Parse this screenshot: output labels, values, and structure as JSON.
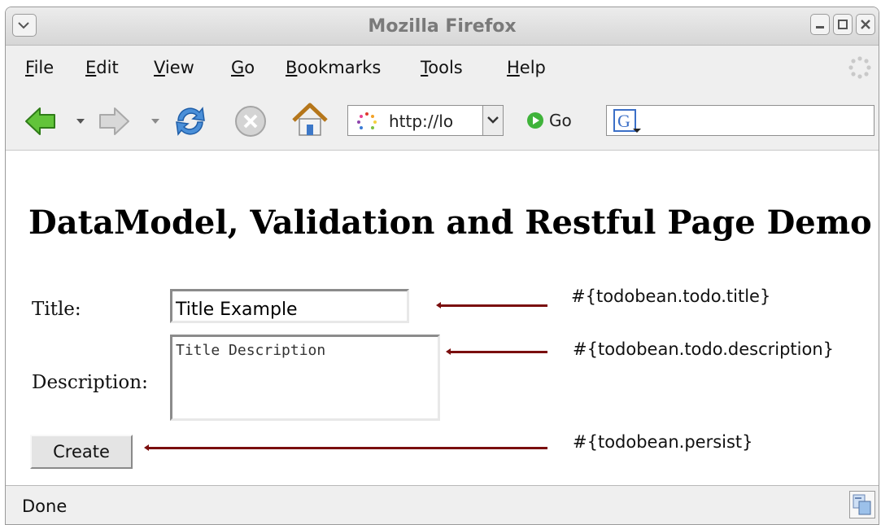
{
  "window": {
    "title": "Mozilla Firefox"
  },
  "menubar": {
    "items": [
      {
        "underline": "F",
        "rest": "ile"
      },
      {
        "underline": "E",
        "rest": "dit"
      },
      {
        "underline": "V",
        "rest": "iew"
      },
      {
        "underline": "G",
        "rest": "o"
      },
      {
        "underline": "B",
        "rest": "ookmarks"
      },
      {
        "underline": "T",
        "rest": "ools"
      },
      {
        "underline": "H",
        "rest": "elp"
      }
    ]
  },
  "toolbar": {
    "url": "http://lo",
    "go_label": "Go",
    "icons": [
      "back-icon",
      "forward-icon",
      "reload-icon",
      "stop-icon",
      "home-icon",
      "google-search-icon"
    ]
  },
  "page": {
    "heading": "DataModel, Validation and Restful Page Demo",
    "form": {
      "title_label": "Title:",
      "title_value": "Title Example",
      "description_label": "Description:",
      "description_value": "Title Description",
      "create_label": "Create"
    },
    "annotations": {
      "title": "#{todobean.todo.title}",
      "description": "#{todobean.todo.description}",
      "persist": "#{todobean.persist}"
    },
    "colors": {
      "annotation_arrow": "#7a0e0e"
    }
  },
  "statusbar": {
    "text": "Done"
  }
}
